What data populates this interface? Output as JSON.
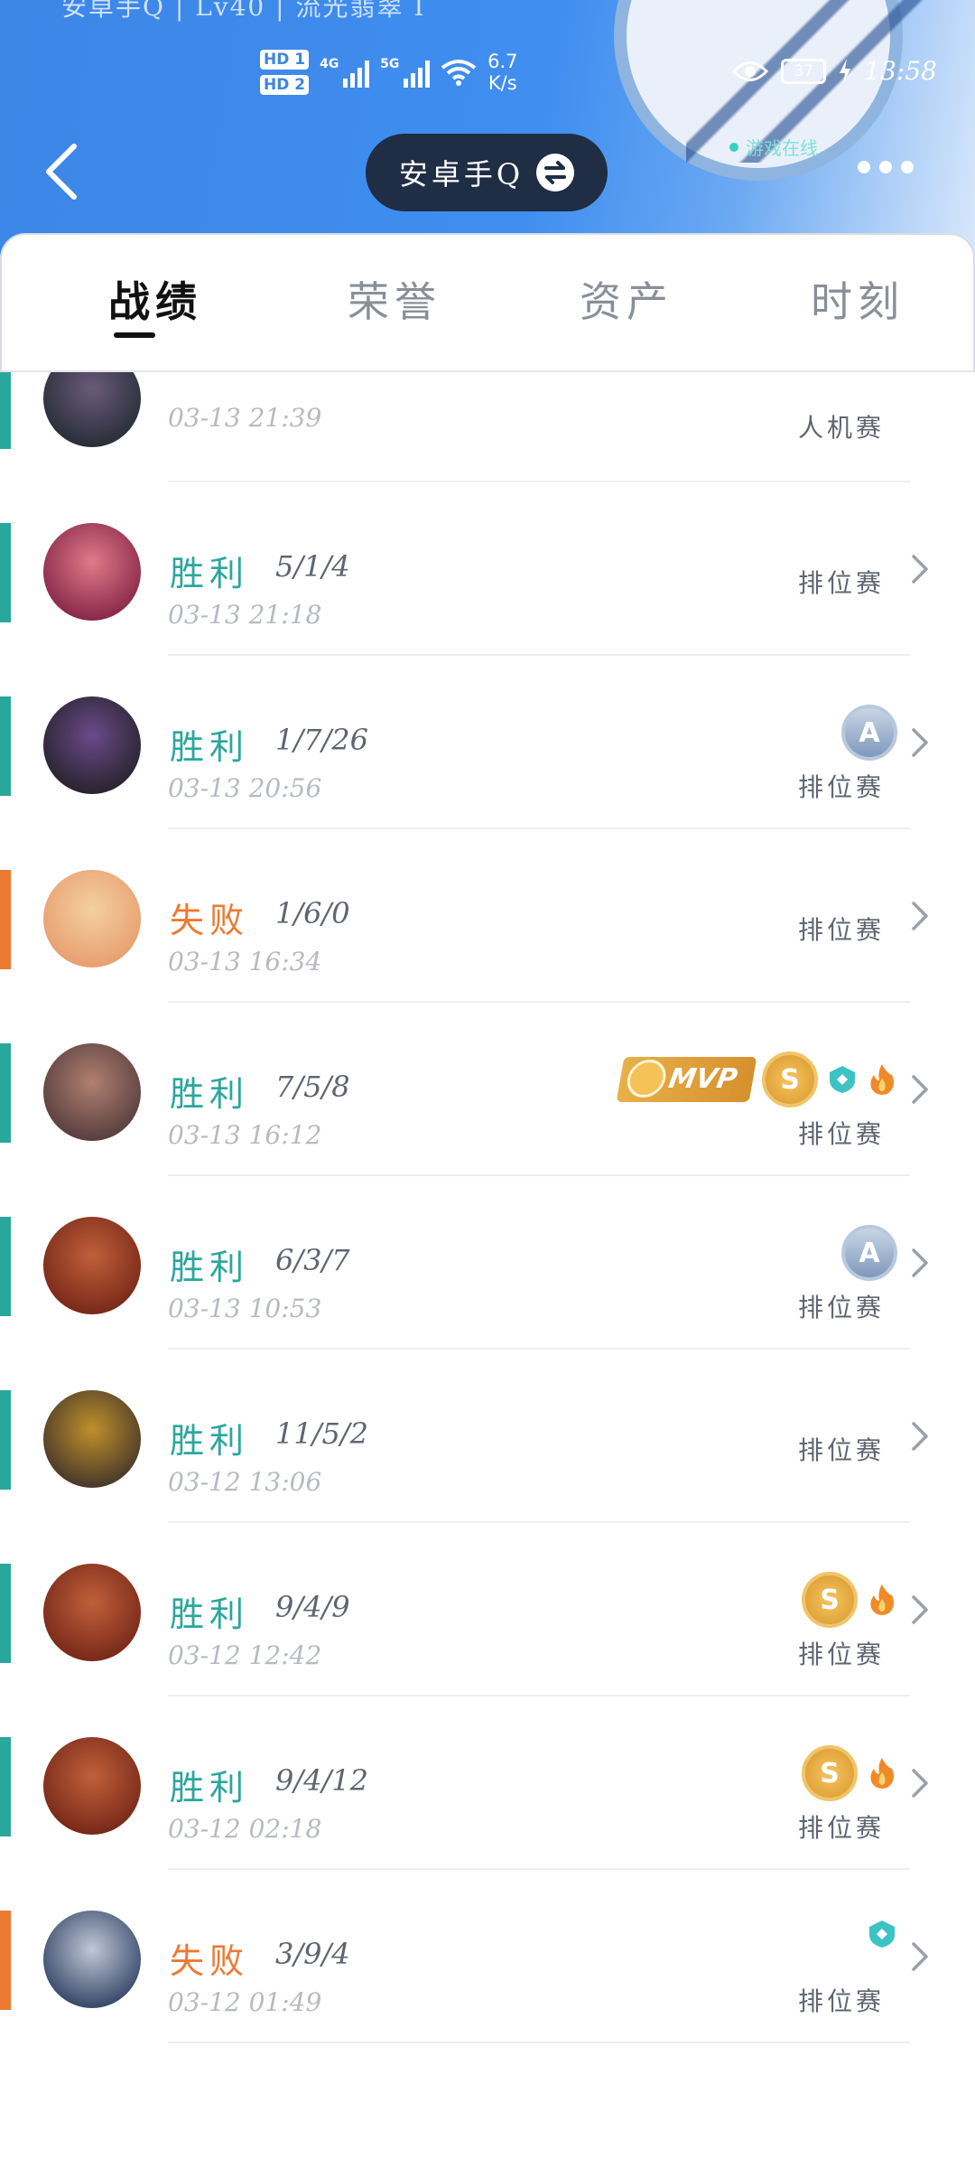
{
  "status_bar": {
    "profile_strip": "安卓手Q | Lv40 | 流光翡翠 I",
    "hd1": "HD 1",
    "hd2": "HD 2",
    "net1": "4G",
    "net2": "5G",
    "speed_value": "6.7",
    "speed_unit": "K/s",
    "battery": "37",
    "time": "13:58"
  },
  "header": {
    "account_switch_label": "安卓手Q",
    "online_status": "游戏在线"
  },
  "tabs": [
    {
      "label": "战绩",
      "active": true
    },
    {
      "label": "荣誉",
      "active": false
    },
    {
      "label": "资产",
      "active": false
    },
    {
      "label": "时刻",
      "active": false
    }
  ],
  "colors": {
    "win": "#2aa79c",
    "lose": "#ec7a32",
    "header_blue": "#3c86e6"
  },
  "matches": [
    {
      "result": "",
      "kda": "",
      "time": "03-13 21:39",
      "mode": "人机赛",
      "badges": [],
      "partial": true
    },
    {
      "result": "胜利",
      "kda": "5/1/4",
      "time": "03-13 21:18",
      "mode": "排位赛",
      "badges": []
    },
    {
      "result": "胜利",
      "kda": "1/7/26",
      "time": "03-13 20:56",
      "mode": "排位赛",
      "badges": [
        "A"
      ]
    },
    {
      "result": "失败",
      "kda": "1/6/0",
      "time": "03-13 16:34",
      "mode": "排位赛",
      "badges": []
    },
    {
      "result": "胜利",
      "kda": "7/5/8",
      "time": "03-13 16:12",
      "mode": "排位赛",
      "badges": [
        "MVP",
        "S",
        "shield",
        "fire"
      ]
    },
    {
      "result": "胜利",
      "kda": "6/3/7",
      "time": "03-13 10:53",
      "mode": "排位赛",
      "badges": [
        "A"
      ]
    },
    {
      "result": "胜利",
      "kda": "11/5/2",
      "time": "03-12 13:06",
      "mode": "排位赛",
      "badges": []
    },
    {
      "result": "胜利",
      "kda": "9/4/9",
      "time": "03-12 12:42",
      "mode": "排位赛",
      "badges": [
        "S",
        "fire"
      ]
    },
    {
      "result": "胜利",
      "kda": "9/4/12",
      "time": "03-12 02:18",
      "mode": "排位赛",
      "badges": [
        "S",
        "fire"
      ]
    },
    {
      "result": "失败",
      "kda": "3/9/4",
      "time": "03-12 01:49",
      "mode": "排位赛",
      "badges": [
        "shield"
      ]
    }
  ],
  "badge_labels": {
    "mvp": "MVP",
    "s": "S",
    "a": "A"
  }
}
